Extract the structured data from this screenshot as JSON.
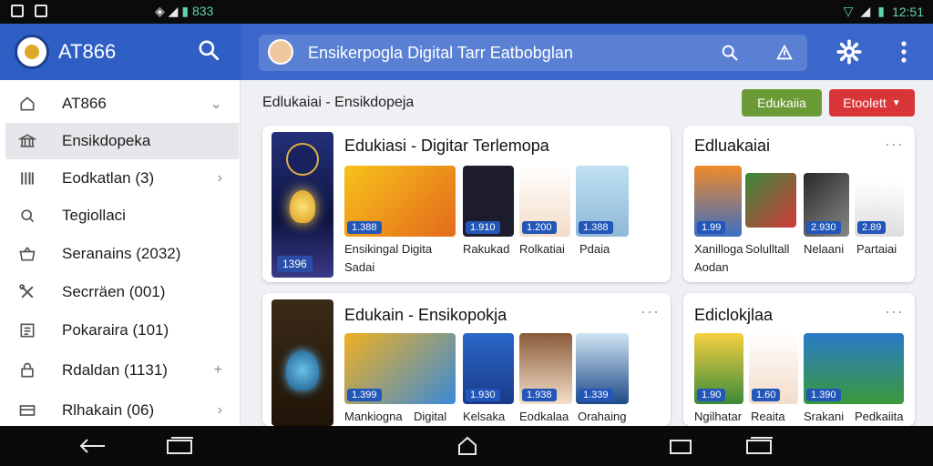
{
  "status_bar": {
    "clock_left": "833",
    "clock_right": "12:51"
  },
  "app": {
    "title": "AT866",
    "search_text": "Ensikerpogla Digital Tarr Eatbobglan"
  },
  "sidebar": {
    "items": [
      {
        "label": "AT866",
        "icon": "home-icon",
        "chevron": "⌄"
      },
      {
        "label": "Ensikdopeka",
        "icon": "bank-icon",
        "chevron": ""
      },
      {
        "label": "Eodkatlan (3)",
        "icon": "bars-icon",
        "chevron": "›"
      },
      {
        "label": "Tegiollaci",
        "icon": "search-icon",
        "chevron": ""
      },
      {
        "label": "Seranains (2032)",
        "icon": "basket-icon",
        "chevron": ""
      },
      {
        "label": "Secrräen (001)",
        "icon": "tools-icon",
        "chevron": ""
      },
      {
        "label": "Pokaraira (101)",
        "icon": "list-icon",
        "chevron": ""
      },
      {
        "label": "Rdaldan (1131)",
        "icon": "lock-icon",
        "chevron": "+"
      },
      {
        "label": "Rlhakain (06)",
        "icon": "card-icon",
        "chevron": "›"
      }
    ]
  },
  "main": {
    "title": "Edlukaiai - Ensikdopeja",
    "btn_green": "Edukaiia",
    "btn_red": "Etoolett"
  },
  "cards": [
    {
      "title": "Edukiasi - Digitar Terlemopa",
      "hero_badge": "1396",
      "thumbs": [
        {
          "price": "1.388",
          "caption": "Ensikingal Digita"
        },
        {
          "price": "1.910",
          "caption": "Rakukad"
        },
        {
          "price": "1.200",
          "caption": "Rolkatiai"
        },
        {
          "price": "1.388",
          "caption": "Pdaia"
        }
      ],
      "subcaption": "Sadai"
    },
    {
      "title": "Edluakaiai",
      "more": "···",
      "thumbs": [
        {
          "price": "1.99",
          "caption": "Xanilloga"
        },
        {
          "price": "",
          "caption": "Solulltall"
        },
        {
          "price": "2.930",
          "caption": "Nelaani"
        },
        {
          "price": "2.89",
          "caption": "Partaiai"
        }
      ],
      "subcaption": "Aodan"
    },
    {
      "title": "Edukain - Ensikopokja",
      "more": "···",
      "thumbs": [
        {
          "price": "1.399",
          "caption": "Mankiogna"
        },
        {
          "price": "",
          "caption": "Digital"
        },
        {
          "price": "1.930",
          "caption": "Kelsaka"
        },
        {
          "price": "1.938",
          "caption": "Eodkalaa"
        },
        {
          "price": "1.339",
          "caption": "Orahaing"
        }
      ]
    },
    {
      "title": "Ediclokjlaa",
      "more": "···",
      "thumbs": [
        {
          "price": "1.90",
          "caption": "Ngilhatar"
        },
        {
          "price": "1.60",
          "caption": "Reaita"
        },
        {
          "price": "1.390",
          "caption": "Srakani"
        },
        {
          "price": "",
          "caption": "Pedkaiita"
        }
      ]
    }
  ],
  "colors": {
    "primary": "#3a67c9",
    "green": "#6a9b34",
    "red": "#d93438",
    "price": "#2256b8"
  }
}
